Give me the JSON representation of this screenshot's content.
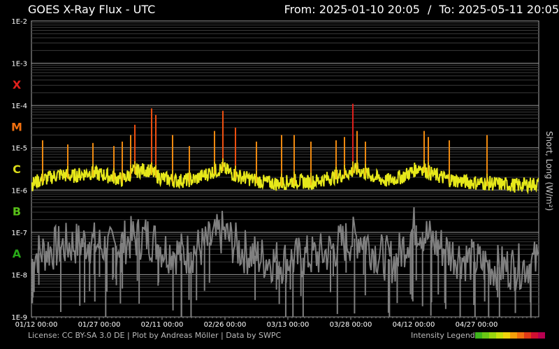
{
  "header": {
    "title": "GOES X-Ray Flux - UTC",
    "from_label": "From:",
    "from_value": "2025-01-10 20:05",
    "separator": "/",
    "to_label": "To:",
    "to_value": "2025-05-11 20:05"
  },
  "footer": {
    "license": "License: CC BY-SA 3.0 DE | Plot by Andreas Möller | Data by SWPC",
    "legend_label": "Intensity Legend",
    "legend_colors": [
      "#3fb41c",
      "#6ac814",
      "#9ad60e",
      "#c8e00c",
      "#f0d40c",
      "#f5a00a",
      "#f07010",
      "#e03a18",
      "#d01030",
      "#b80050"
    ]
  },
  "chart_data": {
    "type": "line",
    "title": "GOES X-Ray Flux - UTC",
    "ylabel": "Short, Long (W/m²)",
    "yscale": "log",
    "ylim": [
      "1E-9",
      "1E-2"
    ],
    "y_ticks": [
      "1E-2",
      "1E-3",
      "1E-4",
      "1E-5",
      "1E-6",
      "1E-7",
      "1E-8",
      "1E-9"
    ],
    "flare_classes": [
      {
        "label": "X",
        "color": "#e0201c"
      },
      {
        "label": "M",
        "color": "#f07010"
      },
      {
        "label": "C",
        "color": "#dcdc1a"
      },
      {
        "label": "B",
        "color": "#58c018"
      },
      {
        "label": "A",
        "color": "#28a818"
      }
    ],
    "xlim": [
      "2025-01-10 20:05",
      "2025-05-11 20:05"
    ],
    "x_ticks": [
      "01/12 00:00",
      "01/27 00:00",
      "02/11 00:00",
      "02/26 00:00",
      "03/13 00:00",
      "03/28 00:00",
      "04/12 00:00",
      "04/27 00:00"
    ],
    "grid": true,
    "series": [
      {
        "name": "Long",
        "color": "#e6e81a",
        "baseline": [
          [
            "01/11",
            1.3e-06
          ],
          [
            "01/14",
            1.6e-06
          ],
          [
            "01/17",
            2e-06
          ],
          [
            "01/20",
            1.8e-06
          ],
          [
            "01/24",
            2.2e-06
          ],
          [
            "01/28",
            1.9e-06
          ],
          [
            "02/01",
            1.5e-06
          ],
          [
            "02/04",
            2.4e-06
          ],
          [
            "02/07",
            2.6e-06
          ],
          [
            "02/10",
            1.7e-06
          ],
          [
            "02/14",
            1.4e-06
          ],
          [
            "02/18",
            1.5e-06
          ],
          [
            "02/22",
            2.2e-06
          ],
          [
            "02/25",
            2.8e-06
          ],
          [
            "02/28",
            1.9e-06
          ],
          [
            "03/03",
            1.6e-06
          ],
          [
            "03/07",
            1.3e-06
          ],
          [
            "03/10",
            1.2e-06
          ],
          [
            "03/14",
            1.4e-06
          ],
          [
            "03/18",
            1.3e-06
          ],
          [
            "03/22",
            1.6e-06
          ],
          [
            "03/26",
            2e-06
          ],
          [
            "03/29",
            2.6e-06
          ],
          [
            "04/01",
            1.9e-06
          ],
          [
            "04/05",
            1.4e-06
          ],
          [
            "04/09",
            1.8e-06
          ],
          [
            "04/13",
            3e-06
          ],
          [
            "04/16",
            2e-06
          ],
          [
            "04/20",
            1.5e-06
          ],
          [
            "04/25",
            1.3e-06
          ],
          [
            "05/01",
            1.2e-06
          ],
          [
            "05/06",
            1.1e-06
          ],
          [
            "05/11",
            1.2e-06
          ]
        ],
        "flares": [
          [
            "01/13",
            1.5e-05
          ],
          [
            "01/19",
            1.2e-05
          ],
          [
            "01/25",
            1.3e-05
          ],
          [
            "01/30",
            1.1e-05
          ],
          [
            "02/01",
            1.4e-05
          ],
          [
            "02/03",
            2e-05
          ],
          [
            "02/04",
            3.5e-05
          ],
          [
            "02/08",
            8.5e-05
          ],
          [
            "02/09",
            6e-05
          ],
          [
            "02/13",
            2e-05
          ],
          [
            "02/17",
            1.1e-05
          ],
          [
            "02/23",
            2.5e-05
          ],
          [
            "02/25",
            7.5e-05
          ],
          [
            "02/28",
            3e-05
          ],
          [
            "03/05",
            1.4e-05
          ],
          [
            "03/11",
            2e-05
          ],
          [
            "03/14",
            2e-05
          ],
          [
            "03/18",
            1.4e-05
          ],
          [
            "03/24",
            1.5e-05
          ],
          [
            "03/26",
            1.8e-05
          ],
          [
            "03/28",
            0.00011
          ],
          [
            "03/29",
            2.5e-05
          ],
          [
            "03/31",
            1.4e-05
          ],
          [
            "04/14",
            2.5e-05
          ],
          [
            "04/15",
            1.8e-05
          ],
          [
            "04/20",
            1.5e-05
          ],
          [
            "04/29",
            2e-05
          ]
        ]
      },
      {
        "name": "Short",
        "color": "#808080",
        "baseline": [
          [
            "01/11",
            3e-08
          ],
          [
            "01/15",
            4e-08
          ],
          [
            "01/19",
            5e-08
          ],
          [
            "01/24",
            6e-08
          ],
          [
            "01/29",
            4e-08
          ],
          [
            "02/03",
            7e-08
          ],
          [
            "02/07",
            8e-08
          ],
          [
            "02/11",
            4e-08
          ],
          [
            "02/16",
            3e-08
          ],
          [
            "02/21",
            5e-08
          ],
          [
            "02/25",
            1e-07
          ],
          [
            "03/01",
            4e-08
          ],
          [
            "03/06",
            2.5e-08
          ],
          [
            "03/11",
            2e-08
          ],
          [
            "03/16",
            2.5e-08
          ],
          [
            "03/21",
            3e-08
          ],
          [
            "03/26",
            6e-08
          ],
          [
            "03/30",
            8e-08
          ],
          [
            "04/03",
            3e-08
          ],
          [
            "04/07",
            2e-08
          ],
          [
            "04/12",
            1.5e-07
          ],
          [
            "04/16",
            6e-08
          ],
          [
            "04/21",
            3e-08
          ],
          [
            "04/26",
            2e-08
          ],
          [
            "05/01",
            1.5e-08
          ],
          [
            "05/06",
            1.5e-08
          ],
          [
            "05/11",
            2e-08
          ]
        ]
      }
    ]
  }
}
